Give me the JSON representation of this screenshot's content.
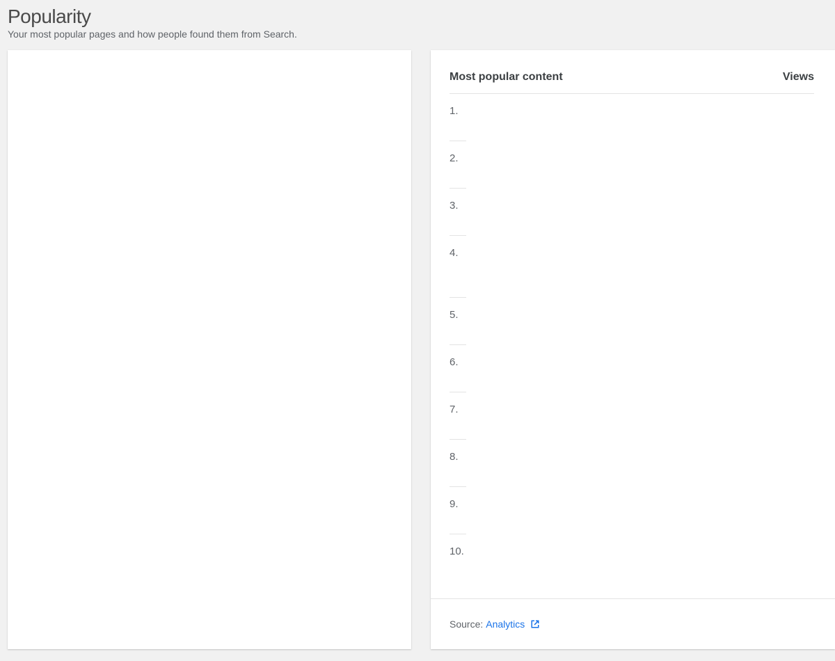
{
  "header": {
    "title": "Popularity",
    "subtitle": "Your most popular pages and how people found them from Search."
  },
  "table": {
    "title_column": "Most popular content",
    "views_column": "Views",
    "rows": [
      {
        "rank": "1."
      },
      {
        "rank": "2."
      },
      {
        "rank": "3."
      },
      {
        "rank": "4."
      },
      {
        "rank": "5."
      },
      {
        "rank": "6."
      },
      {
        "rank": "7."
      },
      {
        "rank": "8."
      },
      {
        "rank": "9."
      },
      {
        "rank": "10."
      }
    ]
  },
  "footer": {
    "source_label": "Source:",
    "source_link": "Analytics",
    "link_icon": "open-in-new-icon"
  },
  "colors": {
    "link": "#1a73e8",
    "background": "#f1f1f1"
  }
}
